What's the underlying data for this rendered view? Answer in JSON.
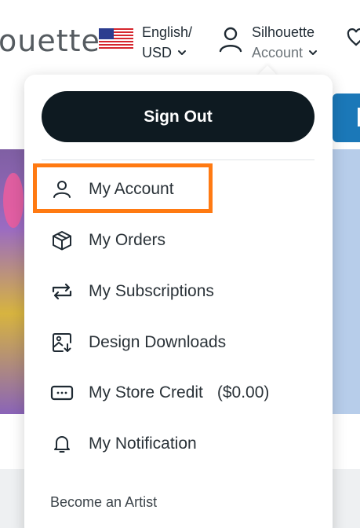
{
  "header": {
    "logo_text": "ouette",
    "language": {
      "line1": "English/",
      "line2": "USD",
      "flag_icon": "us-flag-icon"
    },
    "account": {
      "line1": "Silhouette",
      "line2": "Account",
      "icon": "user-icon"
    },
    "wishlist_icon": "heart-icon"
  },
  "menu": {
    "sign_out": "Sign Out",
    "items": [
      {
        "label": "My Account",
        "icon": "user-icon",
        "highlighted": true
      },
      {
        "label": "My Orders",
        "icon": "box-icon"
      },
      {
        "label": "My Subscriptions",
        "icon": "repeat-icon"
      },
      {
        "label": "Design Downloads",
        "icon": "image-download-icon"
      },
      {
        "label": "My Store Credit",
        "extra": "($0.00)",
        "icon": "ticket-icon"
      },
      {
        "label": "My Notification",
        "icon": "bell-icon"
      }
    ],
    "become_artist": "Become an Artist"
  },
  "colors": {
    "sign_out_bg": "#0e1a21",
    "highlight_border": "#ff7a12",
    "accent_blue": "#1b78b8"
  }
}
